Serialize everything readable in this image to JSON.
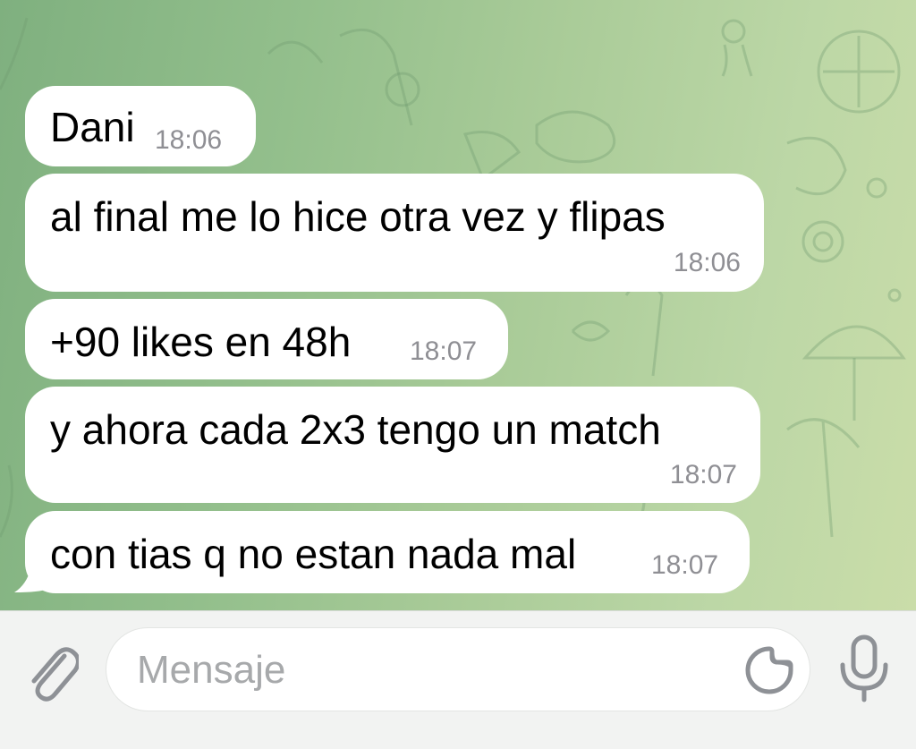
{
  "messages": [
    {
      "text": "Dani",
      "time": "18:06"
    },
    {
      "text": "al final me lo hice otra vez y flipas",
      "time": "18:06"
    },
    {
      "text": "+90 likes en 48h",
      "time": "18:07"
    },
    {
      "text": "y ahora cada 2x3 tengo un match",
      "time": "18:07"
    },
    {
      "text": "con tias q no estan nada mal",
      "time": "18:07"
    }
  ],
  "composer": {
    "placeholder": "Mensaje",
    "attach_icon": "paperclip-icon",
    "sticker_icon": "sticker-icon",
    "mic_icon": "microphone-icon"
  },
  "colors": {
    "bubble": "#ffffff",
    "timestamp": "#8f8f94",
    "wallpaper_left": "#7fb07f",
    "wallpaper_right": "#cadda9",
    "composer_bg": "#f2f3f2",
    "icon": "#8e9196"
  }
}
